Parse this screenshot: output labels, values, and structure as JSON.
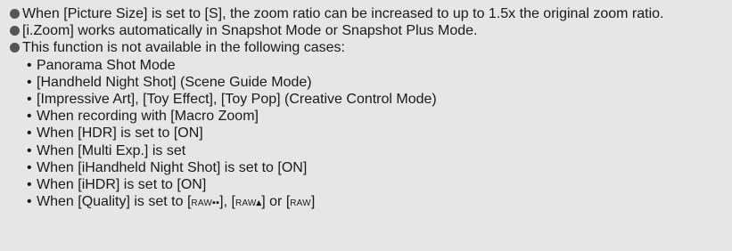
{
  "notes": {
    "bullet_1": "When [Picture Size] is set to [S], the zoom ratio can be increased to up to 1.5x the original zoom ratio.",
    "bullet_2": "[i.Zoom] works automatically in Snapshot Mode or Snapshot Plus Mode.",
    "bullet_3": "This function is not available in the following cases:",
    "sub_bullet_symbol": "•",
    "cases": [
      "Panorama Shot Mode",
      "[Handheld Night Shot] (Scene Guide Mode)",
      "[Impressive Art], [Toy Effect], [Toy Pop] (Creative Control Mode)",
      "When recording with [Macro Zoom]",
      "When [HDR] is set to [ON]",
      "When [Multi Exp.] is set",
      "When [iHandheld Night Shot] is set to [ON]",
      "When [iHDR] is set to [ON]"
    ],
    "quality_case": {
      "prefix": "When [Quality] is set to [",
      "mid_1": "], [",
      "mid_2": "] or [",
      "suffix": "]",
      "icon_1_text": "RAW",
      "icon_1_glyph": "▪▪",
      "icon_2_text": "RAW",
      "icon_2_glyph": "▴",
      "icon_3_text": "RAW"
    }
  },
  "icons": {
    "bullet": "filled-circle-bullet",
    "quality_icon_1": "raw-fine-quality-icon",
    "quality_icon_2": "raw-standard-quality-icon",
    "quality_icon_3": "raw-only-quality-icon"
  },
  "colors": {
    "background": "#e6e6e6",
    "text": "#1a1a1a",
    "bullet": "#555555"
  }
}
